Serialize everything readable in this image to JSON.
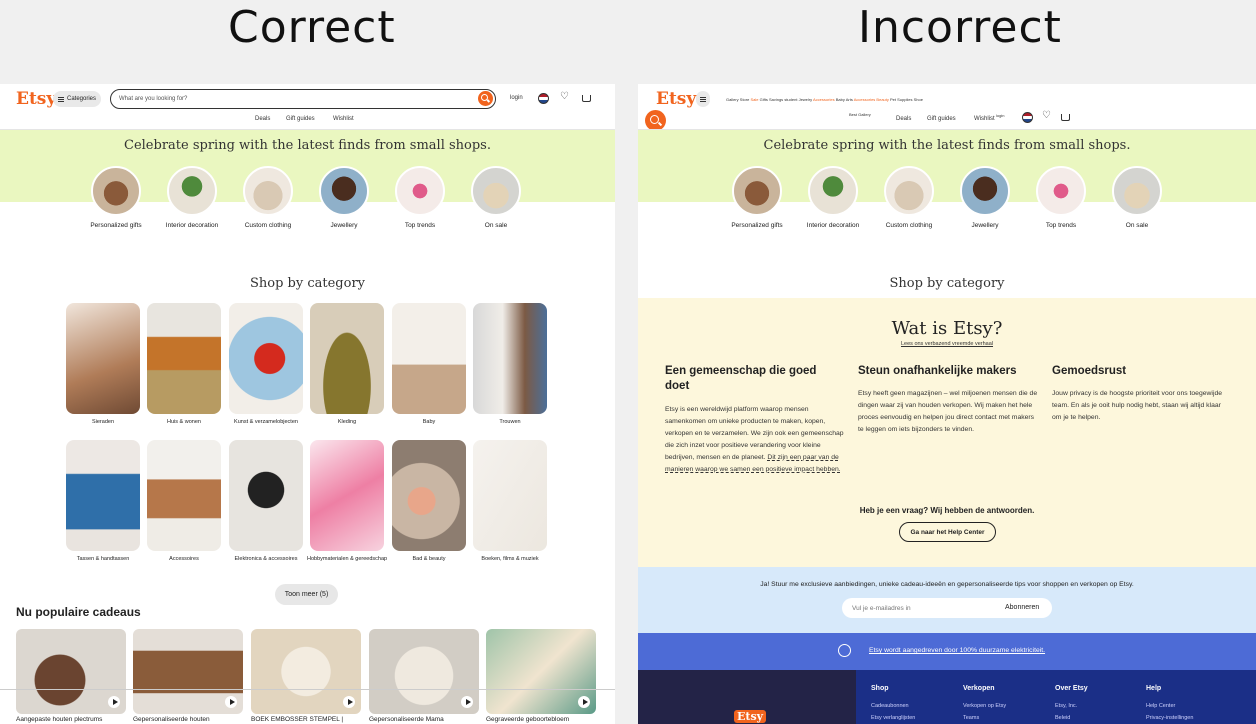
{
  "headings": {
    "correct": "Correct",
    "incorrect": "Incorrect"
  },
  "header": {
    "logo": "Etsy",
    "categories": "Categories",
    "search_placeholder": "What are you looking for?",
    "login": "login",
    "subnav": [
      "Deals",
      "Gift guides",
      "Wishlist"
    ]
  },
  "banner": {
    "title": "Celebrate spring with the latest finds from small shops.",
    "items": [
      "Personalized gifts",
      "Interior decoration",
      "Custom clothing",
      "Jewellery",
      "Top trends",
      "On sale"
    ]
  },
  "category": {
    "title": "Shop by category",
    "tiles": [
      "Sieraden",
      "Huis & wonen",
      "Kunst & verzamelobjecten",
      "Kleding",
      "Baby",
      "Trouwen",
      "Tassen & handtassen",
      "Accessoires",
      "Elektronica & accessoires",
      "Hobbymaterialen & gereedschap",
      "Bad & beauty",
      "Boeken, films & muziek"
    ],
    "more_button": "Toon meer (5)"
  },
  "popular": {
    "title": "Nu populaire cadeaus",
    "items": [
      "Aangepaste houten plectrums",
      "Gepersonaliseerde houten",
      "BOEK EMBOSSER STEMPEL |",
      "Gepersonaliseerde Mama",
      "Gegraveerde geboortebloem"
    ]
  },
  "incorrect": {
    "messy_nav": [
      "Gallery Store",
      "Sale",
      "Gifts Savings",
      "student",
      "Jewelry",
      "Accessories",
      "Baby",
      "Arts",
      "Accessories",
      "Beauty",
      "Pet",
      "Supplies",
      "Shoe"
    ],
    "small_note": "Best Gallery",
    "login": "login",
    "what": {
      "title": "Wat is Etsy?",
      "link": "Lees ons verbazend vreemde verhaal",
      "columns": [
        {
          "title": "Een gemeenschap die goed doet",
          "body": "Etsy is een wereldwijd platform waarop mensen samenkomen om unieke producten te maken, kopen, verkopen en te verzamelen. We zijn ook een gemeenschap die zich inzet voor positieve verandering voor kleine bedrijven, mensen en de planeet.",
          "link": "Dit zijn een paar van de manieren waarop we samen een positieve impact hebben."
        },
        {
          "title": "Steun onafhankelijke makers",
          "body": "Etsy heeft geen magazijnen – wel miljoenen mensen die de dingen waar zij van houden verkopen. Wij maken het hele proces eenvoudig en helpen jou direct contact met makers te leggen om iets bijzonders te vinden."
        },
        {
          "title": "Gemoedsrust",
          "body": "Jouw privacy is de hoogste prioriteit voor ons toegewijde team. En als je ooit hulp nodig hebt, staan wij altijd klaar om je te helpen."
        }
      ],
      "question": "Heb je een vraag? Wij hebben de antwoorden.",
      "help_button": "Ga naar het Help Center"
    },
    "newsletter": {
      "text": "Ja! Stuur me exclusieve aanbiedingen, unieke cadeau-ideeën en gepersonaliseerde tips voor shoppen en verkopen op Etsy.",
      "placeholder": "Vul je e-mailadres in",
      "button": "Abonneren"
    },
    "renewable": "Etsy wordt aangedreven door 100% duurzame elektriciteit.",
    "footer": {
      "columns": [
        {
          "title": "Shop",
          "links": [
            "Cadeaubonnen",
            "Etsy verlanglijsten"
          ]
        },
        {
          "title": "Verkopen",
          "links": [
            "Verkopen op Etsy",
            "Teams"
          ]
        },
        {
          "title": "Over Etsy",
          "links": [
            "Etsy, Inc.",
            "Beleid"
          ]
        },
        {
          "title": "Help",
          "links": [
            "Help Center",
            "Privacy-instellingen"
          ]
        }
      ],
      "logo": "Etsy"
    }
  },
  "colors": {
    "accent": "#f1641e",
    "banner": "#eaf7c0",
    "what_bg": "#fdf7dc",
    "news_bg": "#d7e9fa",
    "blue": "#4d6bd6",
    "dark": "#1b2f87"
  }
}
